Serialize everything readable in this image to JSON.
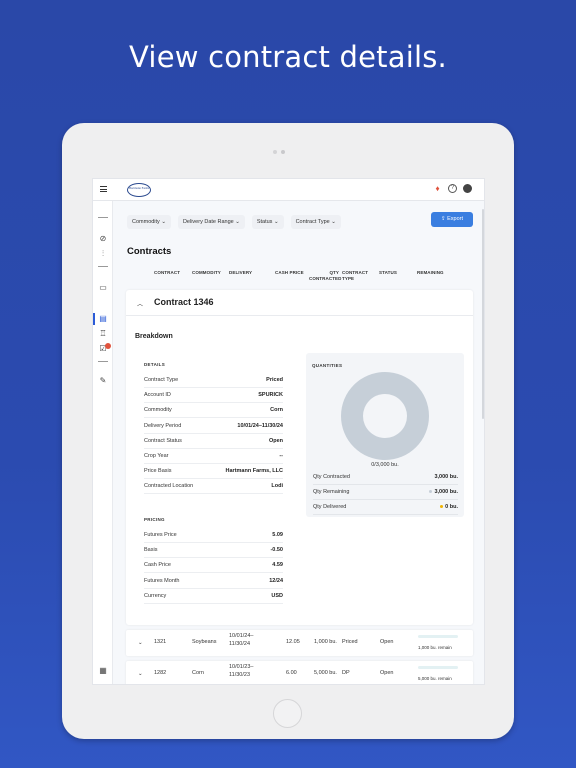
{
  "headline": "View contract details.",
  "app": {
    "logo_text": "Hartmann Farms",
    "topbar_icons": [
      "bell-icon",
      "help-icon",
      "avatar-icon"
    ]
  },
  "sidebar": {
    "icons": [
      "no-sync-icon",
      "sliders-icon",
      "inbox-icon",
      "contracts-icon",
      "scale-icon",
      "tasks-icon",
      "notes-icon",
      "calculator-icon"
    ],
    "active": "contracts-icon",
    "badge_on": "tasks-icon"
  },
  "filters": [
    "Commodity",
    "Delivery Date Range",
    "Status",
    "Contract Type"
  ],
  "export_label": "Export",
  "page_title": "Contracts",
  "columns": {
    "contract": "CONTRACT",
    "commodity": "COMMODITY",
    "delivery": "DELIVERY",
    "cash_price": "CASH PRICE",
    "qty_contracted_1": "QTY",
    "qty_contracted_2": "CONTRACTED",
    "contract_type_1": "CONTRACT",
    "contract_type_2": "TYPE",
    "status": "STATUS",
    "remaining": "REMAINING"
  },
  "expanded": {
    "title": "Contract 1346",
    "breakdown": "Breakdown",
    "details_label": "DETAILS",
    "details": [
      {
        "k": "Contract Type",
        "v": "Priced"
      },
      {
        "k": "Account ID",
        "v": "SPURICK"
      },
      {
        "k": "Commodity",
        "v": "Corn"
      },
      {
        "k": "Delivery Period",
        "v": "10/01/24–11/30/24"
      },
      {
        "k": "Contract Status",
        "v": "Open"
      },
      {
        "k": "Crop Year",
        "v": "--"
      },
      {
        "k": "Price Basis",
        "v": "Hartmann Farms, LLC"
      },
      {
        "k": "Contracted Location",
        "v": "Lodi"
      }
    ],
    "pricing_label": "PRICING",
    "pricing": [
      {
        "k": "Futures Price",
        "v": "5.09"
      },
      {
        "k": "Basis",
        "v": "-0.50"
      },
      {
        "k": "Cash Price",
        "v": "4.59"
      },
      {
        "k": "Futures Month",
        "v": "12/24"
      },
      {
        "k": "Currency",
        "v": "USD"
      }
    ],
    "quantities_label": "QUANTITIES",
    "donut_label": "0/3,000 bu.",
    "delivered_fraction": 0,
    "quantities": [
      {
        "k": "Qty Contracted",
        "v": "3,000 bu.",
        "dot": ""
      },
      {
        "k": "Qty Remaining",
        "v": "3,000 bu.",
        "dot": "#c6cfd8"
      },
      {
        "k": "Qty Delivered",
        "v": "0 bu.",
        "dot": "#f0b400"
      }
    ]
  },
  "rows": [
    {
      "contract": "1321",
      "commodity": "Soybeans",
      "delivery_1": "10/01/24–",
      "delivery_2": "11/30/24",
      "cash_price": "12.05",
      "qty": "1,000 bu.",
      "type": "Priced",
      "status": "Open",
      "remaining": "1,000 bu. remain"
    },
    {
      "contract": "1282",
      "commodity": "Corn",
      "delivery_1": "10/01/23–",
      "delivery_2": "11/30/23",
      "cash_price": "6.00",
      "qty": "5,000 bu.",
      "type": "DP",
      "status": "Open",
      "remaining": "5,000 bu. remain"
    }
  ],
  "colors": {
    "accent": "#3a7ee0",
    "background": "#2b4bb0",
    "badge": "#e0533d"
  }
}
